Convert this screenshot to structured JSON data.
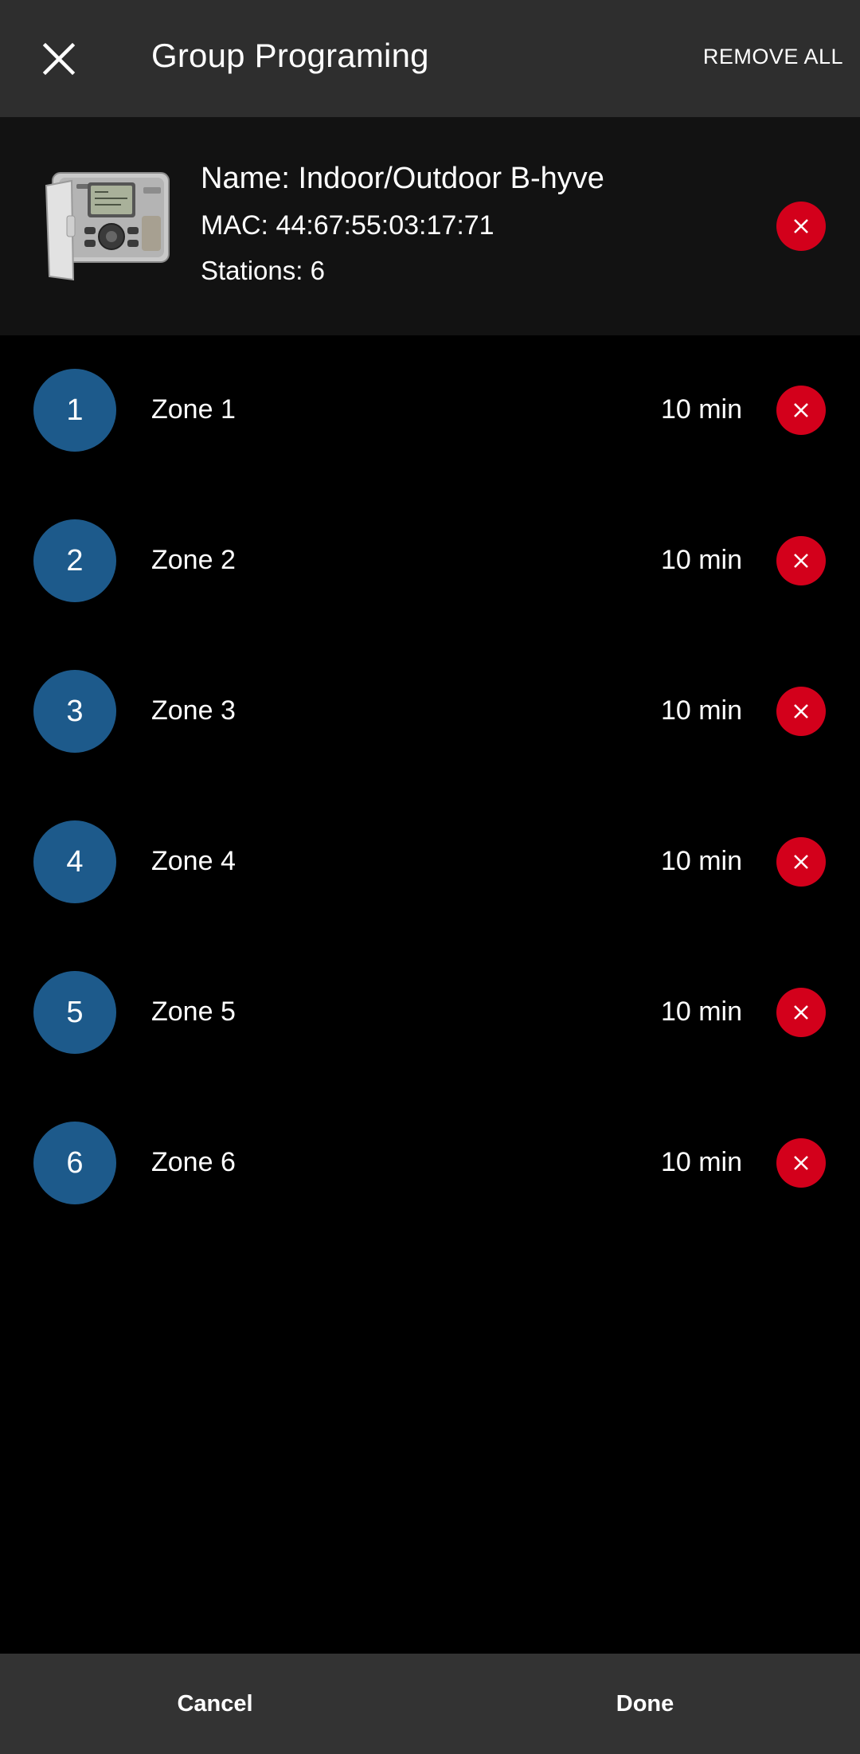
{
  "header": {
    "title": "Group Programing",
    "remove_all_label": "REMOVE ALL",
    "close_icon": "close-icon"
  },
  "device": {
    "name": "Name: Indoor/Outdoor B-hyve",
    "mac": "MAC: 44:67:55:03:17:71",
    "stations": "Stations: 6",
    "image_icon": "sprinkler-controller-image"
  },
  "zones": [
    {
      "number": "1",
      "name": "Zone 1",
      "duration": "10 min"
    },
    {
      "number": "2",
      "name": "Zone 2",
      "duration": "10 min"
    },
    {
      "number": "3",
      "name": "Zone 3",
      "duration": "10 min"
    },
    {
      "number": "4",
      "name": "Zone 4",
      "duration": "10 min"
    },
    {
      "number": "5",
      "name": "Zone 5",
      "duration": "10 min"
    },
    {
      "number": "6",
      "name": "Zone 6",
      "duration": "10 min"
    }
  ],
  "footer": {
    "cancel_label": "Cancel",
    "done_label": "Done"
  },
  "colors": {
    "topbar": "#2e2e2e",
    "card": "#121212",
    "background": "#000000",
    "zone_badge": "#1d5a8b",
    "remove_red": "#d3001b",
    "bottombar": "#333333"
  }
}
